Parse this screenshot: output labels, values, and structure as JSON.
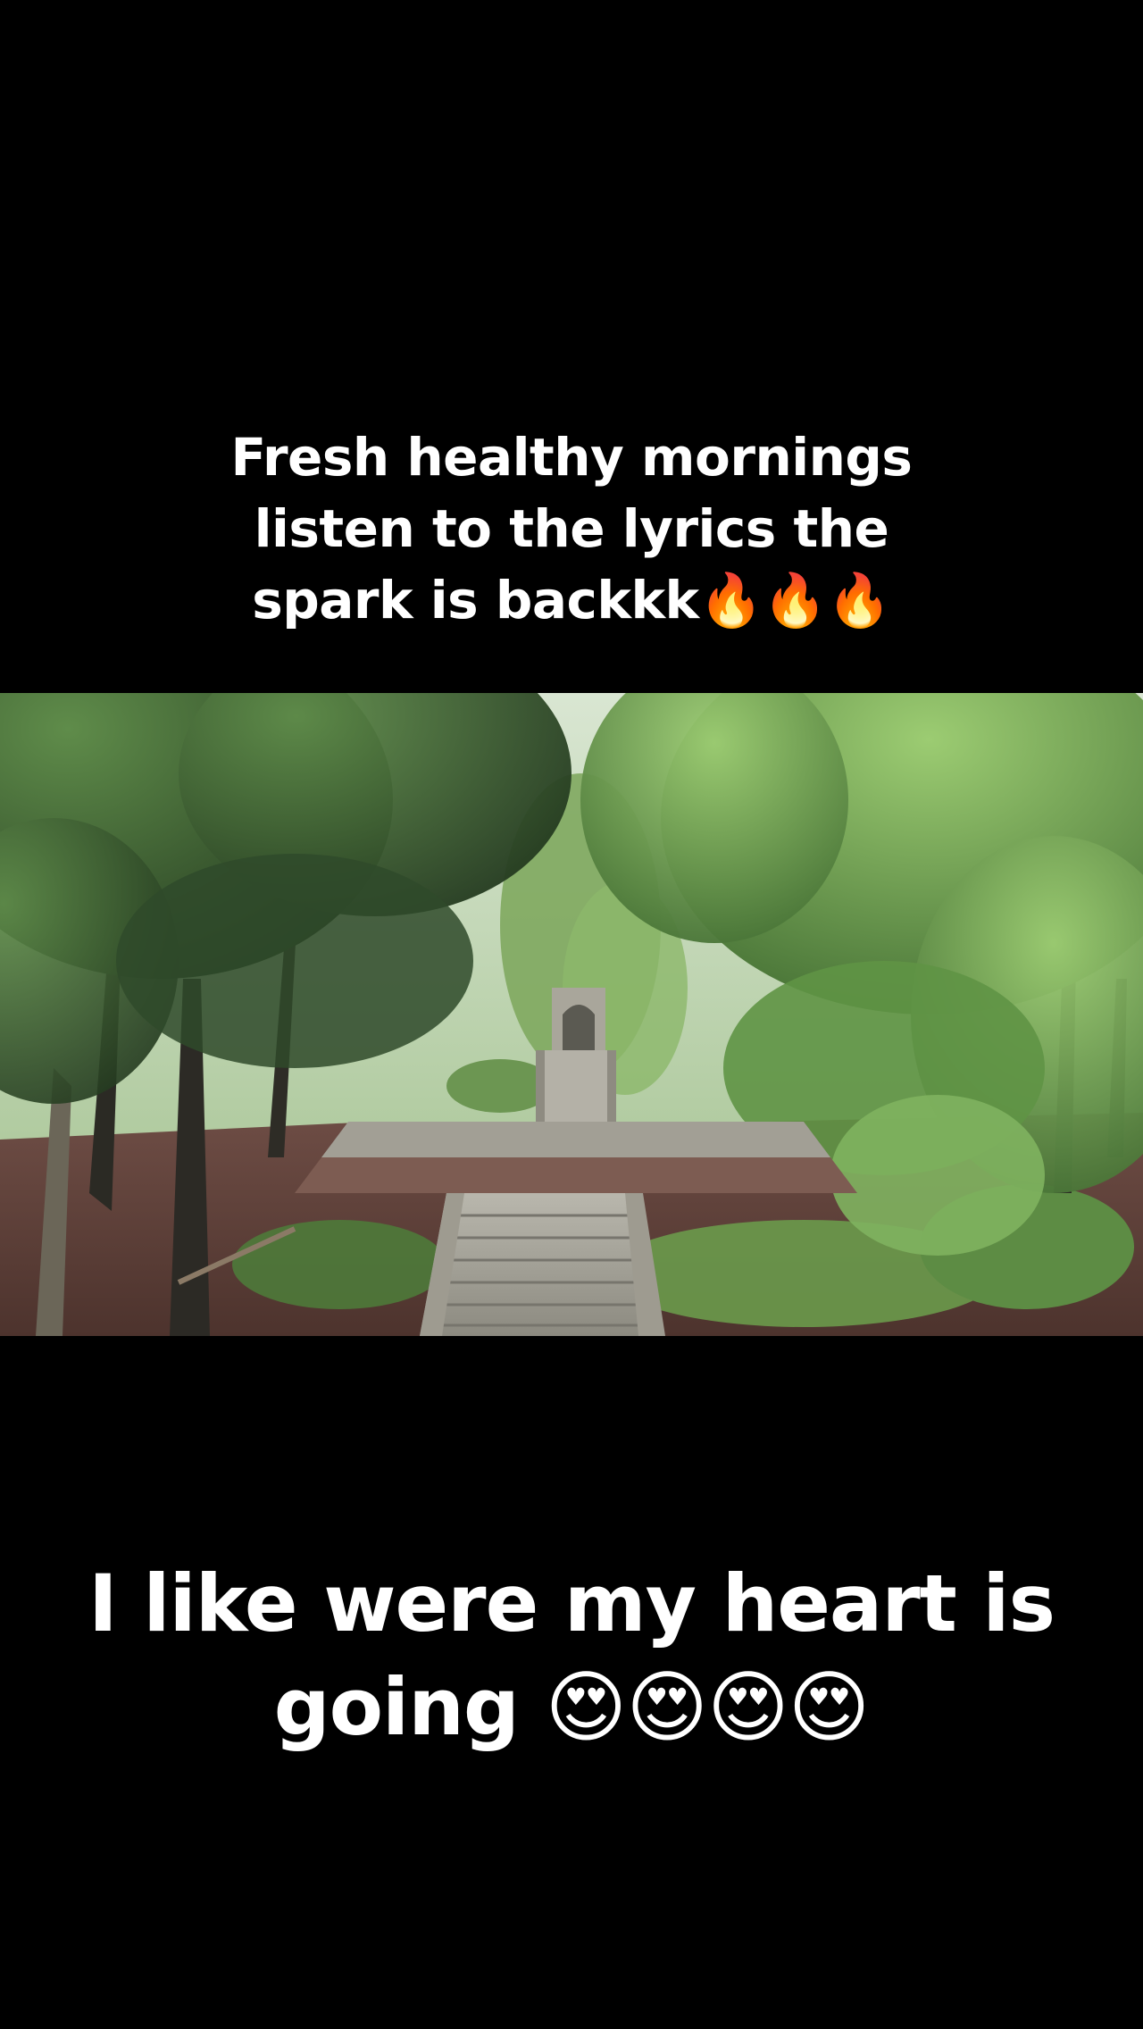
{
  "caption_top": {
    "line1": "Fresh healthy mornings",
    "line2": "listen to the lyrics the",
    "line3": "spark is backkk🔥🔥🔥"
  },
  "photo": {
    "subject": "forest-stone-staircase"
  },
  "caption_bottom": {
    "line1": "I like were my heart is",
    "line2": "going 😍😍😍😍"
  },
  "colors": {
    "background": "#000000",
    "text": "#ffffff",
    "foliage_dark": "#2f4a2a",
    "foliage_light": "#7fb35f",
    "ground": "#5b3d36",
    "stone": "#9a9a92"
  }
}
